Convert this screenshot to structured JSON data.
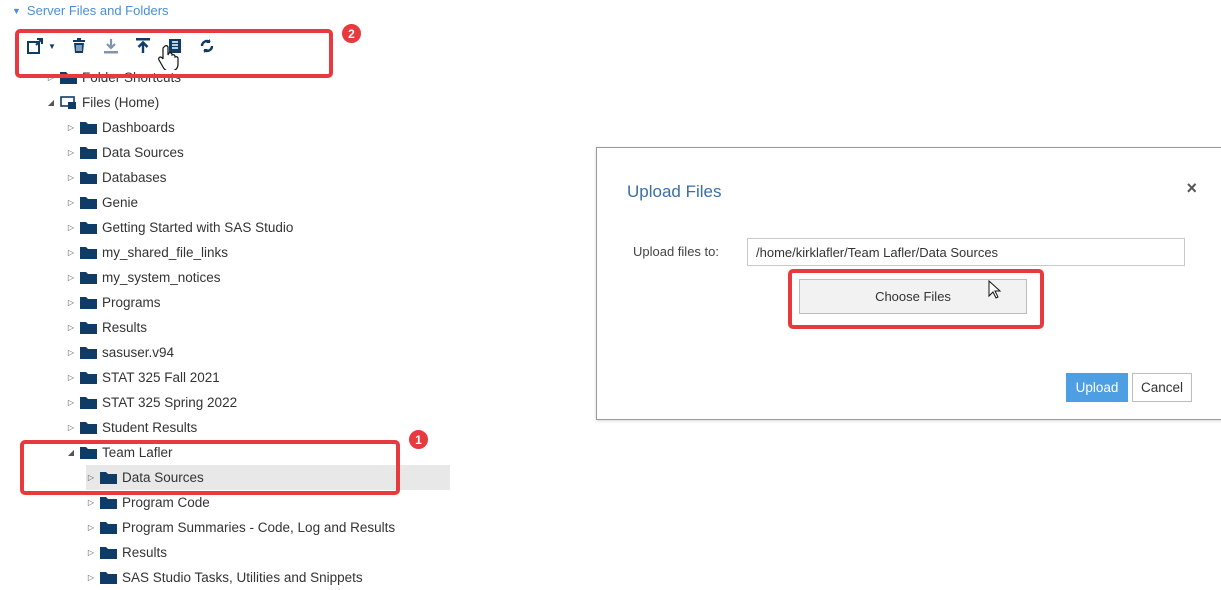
{
  "section": {
    "title": "Server Files and Folders"
  },
  "toolbar": {
    "buttons": [
      {
        "name": "new-icon"
      },
      {
        "name": "delete-icon"
      },
      {
        "name": "download-icon"
      },
      {
        "name": "upload-icon"
      },
      {
        "name": "properties-icon"
      },
      {
        "name": "refresh-icon"
      }
    ]
  },
  "annotations": {
    "badge1": "1",
    "badge2": "2"
  },
  "tree": {
    "folder_shortcuts": "Folder Shortcuts",
    "home": "Files (Home)",
    "items": [
      "Dashboards",
      "Data Sources",
      "Databases",
      "Genie",
      "Getting Started with SAS Studio",
      "my_shared_file_links",
      "my_system_notices",
      "Programs",
      "Results",
      "sasuser.v94",
      "STAT 325 Fall 2021",
      "STAT 325 Spring 2022",
      "Student Results",
      "Team Lafler"
    ],
    "team_children": [
      "Data Sources",
      "Program Code",
      "Program Summaries - Code, Log and Results",
      "Results",
      "SAS Studio Tasks, Utilities and Snippets"
    ]
  },
  "dialog": {
    "title": "Upload Files",
    "close": "×",
    "label": "Upload files to:",
    "path": "/home/kirklafler/Team Lafler/Data Sources",
    "choose": "Choose Files",
    "upload": "Upload",
    "cancel": "Cancel"
  },
  "colors": {
    "accent": "#4d9ee2",
    "folder": "#0f3b67",
    "annotation": "#e63a3f",
    "link": "#4a8fd6"
  }
}
